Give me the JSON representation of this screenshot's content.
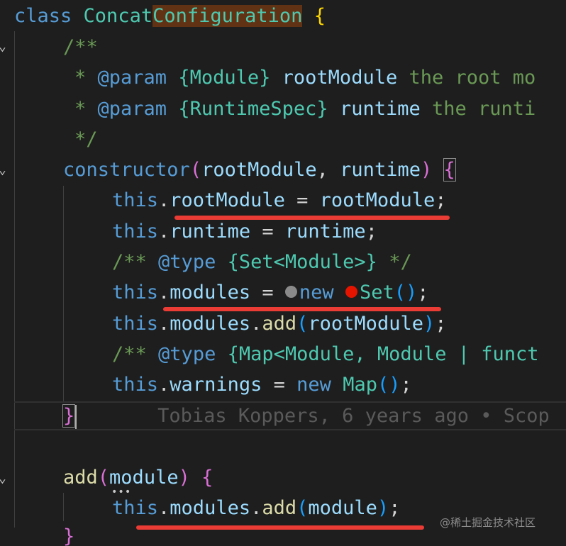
{
  "code": {
    "l1": {
      "kw": "class",
      "name_a": "Concat",
      "name_b": "Configuration",
      "brace": "{"
    },
    "l2": {
      "text": "/**"
    },
    "l3": {
      "star": "*",
      "tag": "@param",
      "type": "{Module}",
      "name": "rootModule",
      "desc": "the root mo"
    },
    "l4": {
      "star": "*",
      "tag": "@param",
      "type": "{RuntimeSpec}",
      "name": "runtime",
      "desc": "the runti"
    },
    "l5": {
      "text": "*/"
    },
    "l6": {
      "fn": "constructor",
      "open": "(",
      "p1": "rootModule",
      "comma": ",",
      "p2": "runtime",
      "close": ")",
      "brace": "{"
    },
    "l7": {
      "this": "this",
      "dot": ".",
      "prop": "rootModule",
      "eq": "=",
      "val": "rootModule",
      "semi": ";"
    },
    "l8": {
      "this": "this",
      "dot": ".",
      "prop": "runtime",
      "eq": "=",
      "val": "runtime",
      "semi": ";"
    },
    "l9": {
      "open": "/**",
      "tag": "@type",
      "type": "{Set<Module>}",
      "close": "*/"
    },
    "l10": {
      "this": "this",
      "dot": ".",
      "prop": "modules",
      "eq": "=",
      "kw": "new",
      "cls": "Set",
      "parens": "()",
      "semi": ";"
    },
    "l11": {
      "this": "this",
      "dot": ".",
      "prop": "modules",
      "dot2": ".",
      "fn": "add",
      "open": "(",
      "arg": "rootModule",
      "close": ")",
      "semi": ";"
    },
    "l12": {
      "open": "/**",
      "tag": "@type",
      "type": "{Map<Module, Module | funct"
    },
    "l13": {
      "this": "this",
      "dot": ".",
      "prop": "warnings",
      "eq": "=",
      "kw": "new",
      "cls": "Map",
      "parens": "()",
      "semi": ";"
    },
    "l14": {
      "brace": "}",
      "blame": "Tobias Koppers, 6 years ago • Scop"
    },
    "l16": {
      "fn": "add",
      "open": "(",
      "param": "module",
      "close": ")",
      "brace": "{"
    },
    "l17": {
      "this": "this",
      "dot": ".",
      "prop": "modules",
      "dot2": ".",
      "fn": "add",
      "open": "(",
      "arg": "module",
      "close": ")",
      "semi": ";"
    },
    "l18": {
      "brace": "}"
    }
  },
  "colors": {
    "underline": "#ea3b35",
    "dot_gray": "#8a8a8a",
    "dot_red": "#e51400"
  },
  "watermark": "@稀土掘金技术社区"
}
